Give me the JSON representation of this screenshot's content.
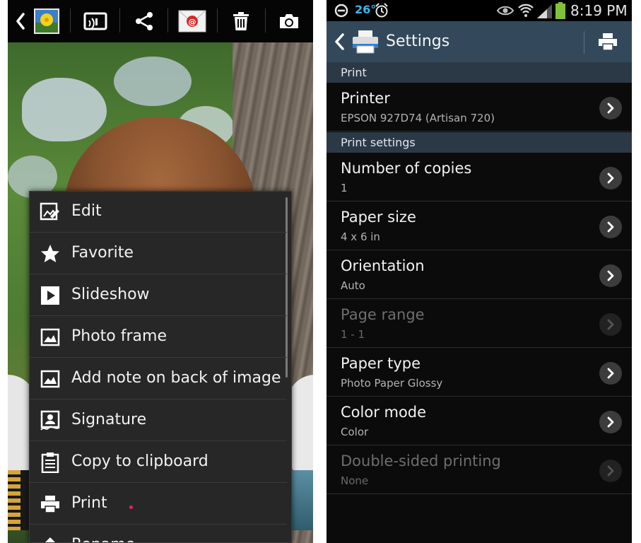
{
  "gallery": {
    "toolbar_icons": [
      "back-icon",
      "thumbnail-icon",
      "screen-mirror-icon",
      "share-icon",
      "email-icon",
      "delete-icon",
      "camera-icon"
    ],
    "menu": {
      "items": [
        {
          "label": "Edit",
          "icon": "edit-icon"
        },
        {
          "label": "Favorite",
          "icon": "star-icon"
        },
        {
          "label": "Slideshow",
          "icon": "play-icon"
        },
        {
          "label": "Photo frame",
          "icon": "picture-icon"
        },
        {
          "label": "Add note on back of image",
          "icon": "picture-icon"
        },
        {
          "label": "Signature",
          "icon": "signature-icon"
        },
        {
          "label": "Copy to clipboard",
          "icon": "clipboard-icon"
        },
        {
          "label": "Print",
          "icon": "printer-icon"
        },
        {
          "label": "Rename",
          "icon": "rename-icon"
        }
      ]
    }
  },
  "settings": {
    "status_bar": {
      "temperature": "26°",
      "time": "8:19 PM"
    },
    "action_bar": {
      "title": "Settings"
    },
    "sections": [
      {
        "label": "Print",
        "rows": [
          {
            "title": "Printer",
            "value": "EPSON 927D74 (Artisan 720)",
            "enabled": true
          }
        ]
      },
      {
        "label": "Print settings",
        "rows": [
          {
            "title": "Number of copies",
            "value": "1",
            "enabled": true
          },
          {
            "title": "Paper size",
            "value": "4 x 6 in",
            "enabled": true
          },
          {
            "title": "Orientation",
            "value": "Auto",
            "enabled": true
          },
          {
            "title": "Page range",
            "value": "1 - 1",
            "enabled": false
          },
          {
            "title": "Paper type",
            "value": "Photo Paper Glossy",
            "enabled": true
          },
          {
            "title": "Color mode",
            "value": "Color",
            "enabled": true
          },
          {
            "title": "Double-sided printing",
            "value": "None",
            "enabled": false
          }
        ]
      }
    ]
  },
  "colors": {
    "action_bar": "#33495b",
    "section_header": "#2b3947",
    "status_accent": "#3fb6e8",
    "menu_background": "#272727"
  }
}
